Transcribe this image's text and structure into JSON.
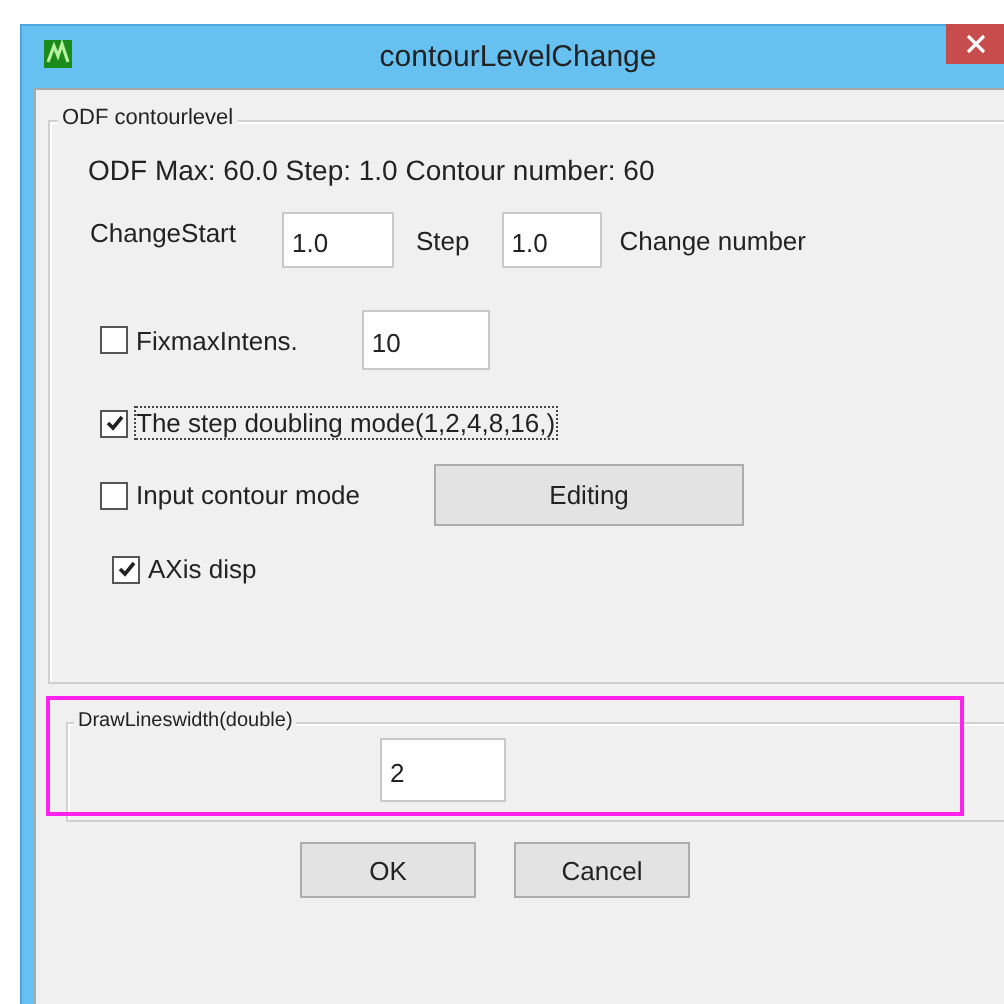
{
  "window": {
    "title": "contourLevelChange"
  },
  "contour_group": {
    "title": "ODF contourlevel",
    "info": "ODF Max: 60.0 Step: 1.0 Contour number: 60",
    "change_start": {
      "label": "ChangeStart",
      "value": "1.0"
    },
    "step": {
      "label": "Step",
      "value": "1.0"
    },
    "change_number_label": "Change number",
    "fixmax": {
      "label": "FixmaxIntens.",
      "checked": false,
      "value": "10"
    },
    "step_doubling": {
      "label": "The step doubling mode(1,2,4,8,16,)",
      "checked": true,
      "focused": true
    },
    "input_contour": {
      "label": "Input contour mode",
      "checked": false,
      "button": "Editing"
    },
    "axis_disp": {
      "label": "AXis disp",
      "checked": true
    }
  },
  "linewidth_group": {
    "title": "DrawLineswidth(double)",
    "value": "2",
    "highlighted": true
  },
  "buttons": [
    "OK",
    "Cancel"
  ]
}
